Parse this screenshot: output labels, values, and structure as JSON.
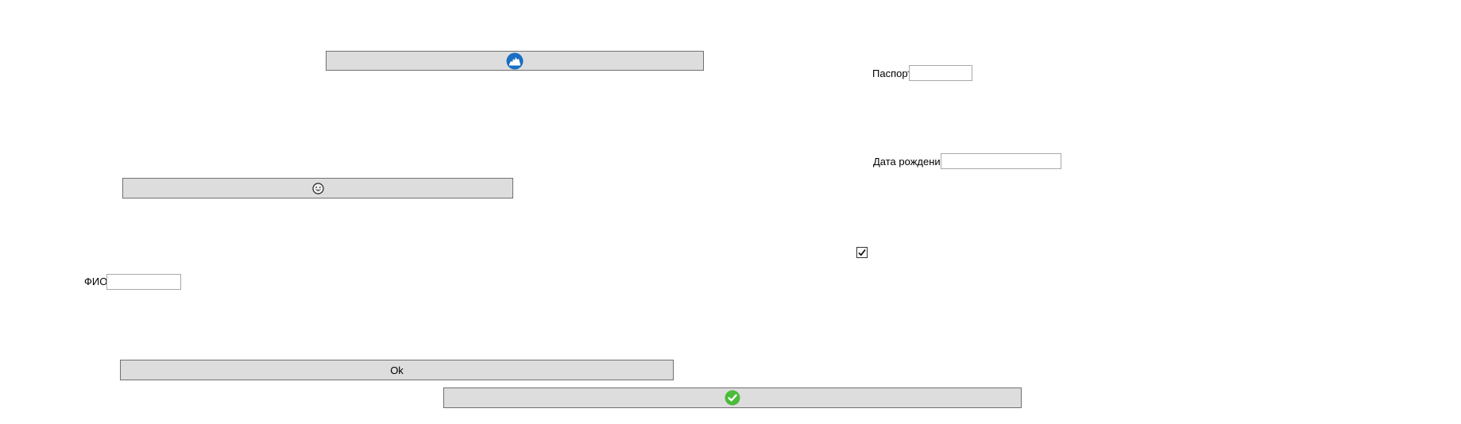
{
  "left_column": {
    "icon_button_top": {
      "icon": "blue-circle-landscape-icon",
      "icon_color": "#1a6fc4"
    },
    "emoji_button": {
      "icon": "grinning-face-icon"
    },
    "fio": {
      "label": "ФИО",
      "value": ""
    },
    "ok_button": {
      "label": "Ok"
    },
    "confirm_button": {
      "icon": "green-checkmark-icon",
      "icon_color": "#4bbb3a"
    }
  },
  "right_column": {
    "passport": {
      "label": "Паспорт",
      "value": ""
    },
    "birth_date": {
      "label": "Дата рождения",
      "value": ""
    },
    "checkbox": {
      "checked": true
    }
  },
  "colors": {
    "button_bg": "#dddddd",
    "button_border": "#707070",
    "field_border": "#a9a9a9"
  }
}
